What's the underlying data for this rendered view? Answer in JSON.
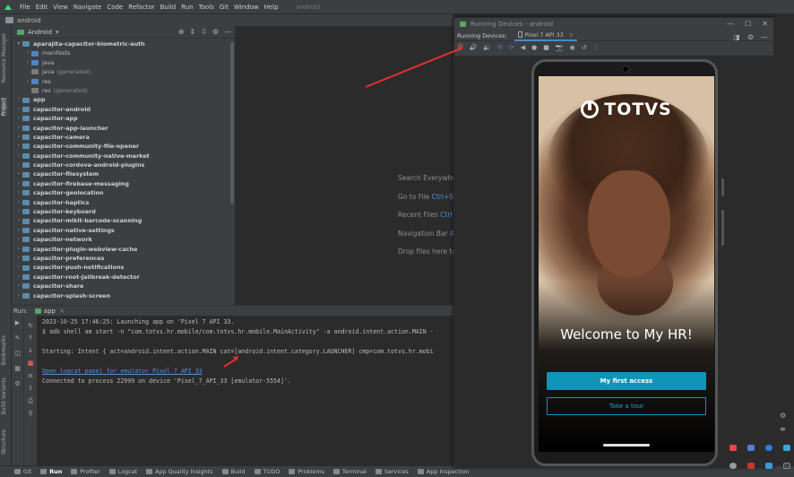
{
  "menubar": {
    "items": [
      "File",
      "Edit",
      "View",
      "Navigate",
      "Code",
      "Refactor",
      "Build",
      "Run",
      "Tools",
      "Git",
      "Window",
      "Help"
    ],
    "project": "android"
  },
  "project_bar": {
    "title": "android"
  },
  "left_strip": {
    "labels": [
      "Resource Manager",
      "Project",
      "Bookmarks",
      "Build Variants",
      "Structure"
    ]
  },
  "project_panel": {
    "view": "Android",
    "tree": [
      {
        "label": "aparajita-capacitor-biometric-auth",
        "bold": true,
        "indent": 0,
        "arrow": "▾",
        "icon": "mod"
      },
      {
        "label": "manifests",
        "indent": 1,
        "arrow": "›",
        "icon": "blue"
      },
      {
        "label": "java",
        "indent": 1,
        "arrow": "›",
        "icon": "blue"
      },
      {
        "label": "java",
        "suffix": "(generated)",
        "indent": 1,
        "arrow": "",
        "icon": "gen"
      },
      {
        "label": "res",
        "indent": 1,
        "arrow": "›",
        "icon": "blue"
      },
      {
        "label": "res",
        "suffix": "(generated)",
        "indent": 1,
        "arrow": "",
        "icon": "gen"
      },
      {
        "label": "app",
        "bold": true,
        "indent": 0,
        "arrow": "›",
        "icon": "mod"
      },
      {
        "label": "capacitor-android",
        "bold": true,
        "indent": 0,
        "arrow": "›",
        "icon": "mod"
      },
      {
        "label": "capacitor-app",
        "bold": true,
        "indent": 0,
        "arrow": "›",
        "icon": "mod"
      },
      {
        "label": "capacitor-app-launcher",
        "bold": true,
        "indent": 0,
        "arrow": "›",
        "icon": "mod"
      },
      {
        "label": "capacitor-camera",
        "bold": true,
        "indent": 0,
        "arrow": "›",
        "icon": "mod"
      },
      {
        "label": "capacitor-community-file-opener",
        "bold": true,
        "indent": 0,
        "arrow": "›",
        "icon": "mod"
      },
      {
        "label": "capacitor-community-native-market",
        "bold": true,
        "indent": 0,
        "arrow": "›",
        "icon": "mod"
      },
      {
        "label": "capacitor-cordova-android-plugins",
        "bold": true,
        "indent": 0,
        "arrow": "›",
        "icon": "mod"
      },
      {
        "label": "capacitor-filesystem",
        "bold": true,
        "indent": 0,
        "arrow": "›",
        "icon": "mod"
      },
      {
        "label": "capacitor-firebase-messaging",
        "bold": true,
        "indent": 0,
        "arrow": "›",
        "icon": "mod"
      },
      {
        "label": "capacitor-geolocation",
        "bold": true,
        "indent": 0,
        "arrow": "›",
        "icon": "mod"
      },
      {
        "label": "capacitor-haptics",
        "bold": true,
        "indent": 0,
        "arrow": "›",
        "icon": "mod"
      },
      {
        "label": "capacitor-keyboard",
        "bold": true,
        "indent": 0,
        "arrow": "›",
        "icon": "mod"
      },
      {
        "label": "capacitor-mlkit-barcode-scanning",
        "bold": true,
        "indent": 0,
        "arrow": "›",
        "icon": "mod"
      },
      {
        "label": "capacitor-native-settings",
        "bold": true,
        "indent": 0,
        "arrow": "›",
        "icon": "mod"
      },
      {
        "label": "capacitor-network",
        "bold": true,
        "indent": 0,
        "arrow": "›",
        "icon": "mod"
      },
      {
        "label": "capacitor-plugin-webview-cache",
        "bold": true,
        "indent": 0,
        "arrow": "›",
        "icon": "mod"
      },
      {
        "label": "capacitor-preferences",
        "bold": true,
        "indent": 0,
        "arrow": "›",
        "icon": "mod"
      },
      {
        "label": "capacitor-push-notifications",
        "bold": true,
        "indent": 0,
        "arrow": "›",
        "icon": "mod"
      },
      {
        "label": "capacitor-root-jailbreak-detector",
        "bold": true,
        "indent": 0,
        "arrow": "›",
        "icon": "mod"
      },
      {
        "label": "capacitor-share",
        "bold": true,
        "indent": 0,
        "arrow": "›",
        "icon": "mod"
      },
      {
        "label": "capacitor-splash-screen",
        "bold": true,
        "indent": 0,
        "arrow": "›",
        "icon": "mod"
      }
    ]
  },
  "editor": {
    "hints": [
      {
        "label": "Search Everywhe",
        "key": ""
      },
      {
        "label": "Go to File",
        "key": "Ctrl+S"
      },
      {
        "label": "Recent Files",
        "key": "Ctrl"
      },
      {
        "label": "Navigation Bar",
        "key": "A"
      },
      {
        "label": "Drop files here to",
        "key": ""
      }
    ]
  },
  "run": {
    "label": "Run:",
    "tab": "app",
    "lines": [
      {
        "text": "2023-10-25 17:46:25: Launching app on 'Pixel 7 API 33.",
        "link": false
      },
      {
        "text": "$ adb shell am start -n \"com.totvs.hr.mobile/com.totvs.hr.mobile.MainActivity\" -a android.intent.action.MAIN -",
        "link": false
      },
      {
        "text": "",
        "link": false
      },
      {
        "text": "Starting: Intent { act=android.intent.action.MAIN cat=[android.intent.category.LAUNCHER] cmp=com.totvs.hr.mobi",
        "link": false
      },
      {
        "text": "",
        "link": false
      },
      {
        "text": "Open logcat panel for emulator Pixel 7 API 33",
        "link": true
      },
      {
        "text": "Connected to process 22999 on device 'Pixel_7_API_33 [emulator-5554]'.",
        "link": false
      }
    ]
  },
  "statusbar": {
    "items": [
      "Git",
      "Run",
      "Profiler",
      "Logcat",
      "App Quality Insights",
      "Build",
      "TODO",
      "Problems",
      "Terminal",
      "Services",
      "App Inspection"
    ],
    "active": "Run"
  },
  "running_devices": {
    "title": "Running Devices - android",
    "label": "Running Devices:",
    "device": "Pixel 7 API 33"
  },
  "app": {
    "brand": "TOTVS",
    "welcome": "Welcome to My HR!",
    "primary_button": "My first access",
    "secondary_button": "Take a tour",
    "accent": "#0f95b5"
  }
}
